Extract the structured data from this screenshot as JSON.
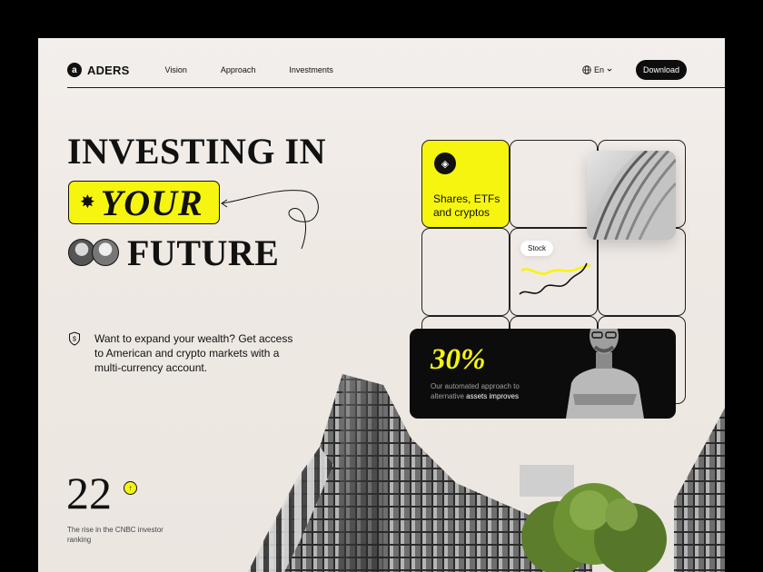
{
  "brand": {
    "logo_mark": "a",
    "name": "ADERS"
  },
  "nav": {
    "links": [
      "Vision",
      "Approach",
      "Investments"
    ],
    "language": "En",
    "download_label": "Download"
  },
  "hero": {
    "line1": "INVESTING IN",
    "highlight": "YOUR",
    "highlight_symbol": "✸",
    "line3": "FUTURE",
    "description": "Want to expand your wealth? Get access to American and crypto markets with a multi-currency account."
  },
  "stat": {
    "value": "22",
    "arrow": "↑",
    "caption": "The rise in the CNBC investor ranking"
  },
  "grid": {
    "coin_symbol": "◈",
    "asset_card_text": "Shares, ETFs and cryptos",
    "stock_label": "Stock"
  },
  "promo_card": {
    "percent": "30%",
    "text_prefix": "Our automated approach to alternative",
    "text_highlight": "assets improves"
  },
  "icons": [
    "globe-icon",
    "chevron-down-icon",
    "shield-icon",
    "arrow-up-icon",
    "crypto-coin-icon"
  ],
  "colors": {
    "accent": "#f5f50f",
    "dark": "#0c0c0c",
    "background": "#efe9e4"
  }
}
